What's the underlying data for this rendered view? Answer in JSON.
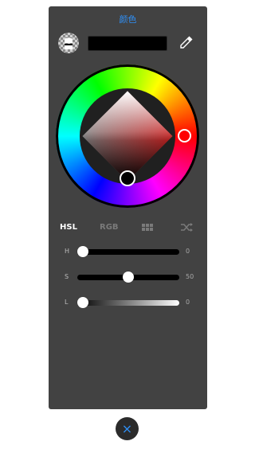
{
  "dialog": {
    "title": "颜色",
    "accent_color": "#2f8ff5",
    "hex_value": ""
  },
  "tabs": [
    {
      "label": "HSL",
      "active": true
    },
    {
      "label": "RGB",
      "active": false
    },
    {
      "icon": "swatch-grid-icon",
      "active": false
    },
    {
      "icon": "shuffle-icon",
      "active": false
    }
  ],
  "sliders": {
    "h": {
      "label": "H",
      "value": "0",
      "level": 0
    },
    "s": {
      "label": "S",
      "value": "50",
      "level": 0.5
    },
    "l": {
      "label": "L",
      "value": "0",
      "level": 0
    }
  },
  "close_button": {
    "glyph": "×"
  }
}
